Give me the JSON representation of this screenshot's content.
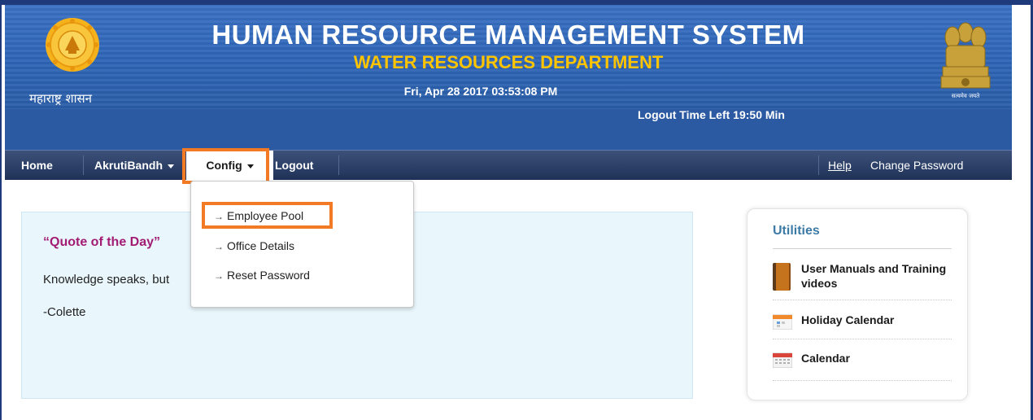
{
  "header": {
    "state_label": "महाराष्ट्र शासन",
    "title": "HUMAN RESOURCE MANAGEMENT SYSTEM",
    "subtitle": "WATER RESOURCES DEPARTMENT",
    "datetime": "Fri, Apr 28 2017   03:53:08 PM",
    "logout_time": "Logout Time Left 19:50 Min",
    "emblem_motto": "सत्यमेव जयते"
  },
  "nav": {
    "home": "Home",
    "akrutibandh": "AkrutiBandh",
    "config": "Config",
    "logout": "Logout",
    "help": "Help",
    "change_password": "Change Password"
  },
  "config_menu": {
    "items": [
      {
        "label": "Employee Pool"
      },
      {
        "label": "Office Details"
      },
      {
        "label": "Reset Password"
      }
    ]
  },
  "quote": {
    "title": "“Quote of the Day”",
    "text": "Knowledge speaks, but",
    "author": "-Colette"
  },
  "utilities": {
    "title": "Utilities",
    "items": [
      {
        "label": "User Manuals and Training videos",
        "icon": "book-icon"
      },
      {
        "label": "Holiday Calendar",
        "icon": "holiday-calendar-icon"
      },
      {
        "label": "Calendar",
        "icon": "calendar-icon"
      }
    ]
  },
  "colors": {
    "header_blue": "#2f66b8",
    "subtitle_yellow": "#ffc400",
    "nav_dark": "#2b3f66",
    "highlight_orange": "#f27a24",
    "quote_title": "#a21c74",
    "util_title": "#3d7aa6"
  }
}
